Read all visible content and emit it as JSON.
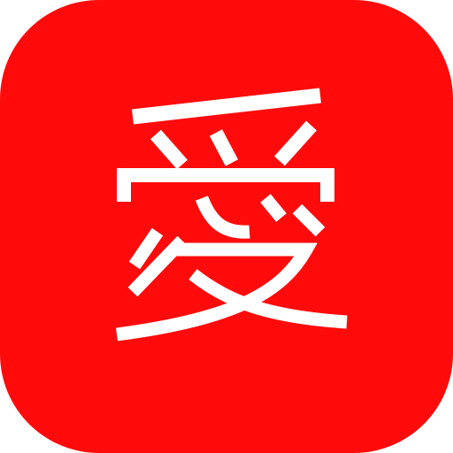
{
  "app_icon": {
    "icon": "app-icon-glyph-ai",
    "glyph_text": "愛",
    "background_color": "#ff0b0b",
    "glyph_color": "#ffffff"
  }
}
